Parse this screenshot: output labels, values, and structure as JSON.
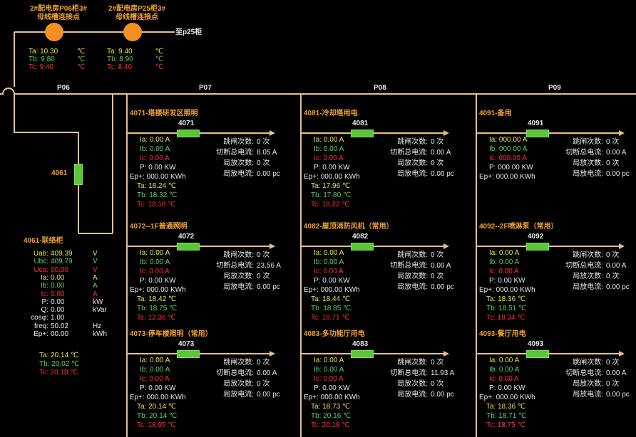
{
  "top_nodes": [
    {
      "line1": "2#配电房P06柜3#",
      "line2": "母线槽连接点",
      "ta": "10.30",
      "tb": "9.80",
      "tc": "9.40",
      "unit": "℃"
    },
    {
      "line1": "2#配电房P25柜3#",
      "line2": "母线槽连接点",
      "ta": "9.40",
      "tb": "8.90",
      "tc": "8.40",
      "unit": "℃"
    }
  ],
  "to_p25": "至p25柜",
  "bus_labels": [
    "P06",
    "P07",
    "P08",
    "P09"
  ],
  "ta_label": "Ta:",
  "tb_label": "Tb:",
  "tc_label": "Tc:",
  "breaker_4061": "4061",
  "tie": {
    "title": "4061-联络柜",
    "rows": [
      {
        "label": "Uab:",
        "value": "409.39",
        "unit": "V",
        "color": "y"
      },
      {
        "label": "Ubc:",
        "value": "409.79",
        "unit": "V",
        "color": "g"
      },
      {
        "label": "Uca:",
        "value": "00.00",
        "unit": "V",
        "color": "r"
      },
      {
        "label": "Ia:",
        "value": "0.00",
        "unit": "A",
        "color": "y"
      },
      {
        "label": "Ib:",
        "value": "0.00",
        "unit": "A",
        "color": "g"
      },
      {
        "label": "Ic:",
        "value": "0.00",
        "unit": "A",
        "color": "r"
      },
      {
        "label": "P:",
        "value": "0.00",
        "unit": "kW",
        "color": "w"
      },
      {
        "label": "Q:",
        "value": "0.00",
        "unit": "kVar",
        "color": "w"
      },
      {
        "label": "cosφ:",
        "value": "1.00",
        "unit": "",
        "color": "w"
      },
      {
        "label": "freq:",
        "value": "50.02",
        "unit": "Hz",
        "color": "w"
      },
      {
        "label": "Ep+:",
        "value": "00.00",
        "unit": "kWh",
        "color": "w"
      }
    ],
    "ta": "Ta: 20.14 ℃",
    "tb": "Tb: 20.02 ℃",
    "tc": "Tc: 20.18 ℃"
  },
  "feeders": [
    {
      "title": "4071-塔楼研发区照明",
      "code": "4071",
      "ia": "Ia: 0.00 A",
      "ib": "Ib: 0.00 A",
      "ic": "Ic: 0.00 A",
      "p": "P: 0.00 KW",
      "ep": "Ep+: 000.00 KWh",
      "ta": "Ta: 18.24 ℃",
      "tb": "Tb: 18.32 ℃",
      "tc": "Tc: 18.18 ℃",
      "trip": "0 次",
      "trip_i": "8.05 A",
      "pd": "0 次",
      "pd_i": "0.00 pc"
    },
    {
      "title": "4081-冷却塔用电",
      "code": "4081",
      "ia": "Ia: 0.00 A",
      "ib": "Ib: 0.00 A",
      "ic": "Ic: 0.00 A",
      "p": "P: 0.00 KW",
      "ep": "Ep+: 000.00 KWh",
      "ta": "Ta: 17.96 ℃",
      "tb": "Tb: 17.80 ℃",
      "tc": "Tc: 18.22 ℃",
      "trip": "0 次",
      "trip_i": "0.00 A",
      "pd": "0 次",
      "pd_i": "0.00 pc"
    },
    {
      "title": "4091-备用",
      "code": "4091",
      "ia": "Ia: 000.00 A",
      "ib": "Ib: 000.00 A",
      "ic": "Ic: 000.00 A",
      "p": "P: 000.00 KW",
      "ep": "Ep+: 000.00 KWh",
      "ta": "",
      "tb": "",
      "tc": "",
      "trip": "0 次",
      "trip_i": "0.00 A",
      "pd": "0 次",
      "pd_i": "0.00 pc"
    },
    {
      "title": "4072--1F普通照明",
      "code": "4072",
      "ia": "Ia: 0.00 A",
      "ib": "Ib: 0.00 A",
      "ic": "Ic: 0.00 A",
      "p": "P: 0.00 KW",
      "ep": "Ep+: 000.00 KWh",
      "ta": "Ta: 18.42 ℃",
      "tb": "Tb: 18.75 ℃",
      "tc": "Tc: 12.36 ℃",
      "trip": "0 次",
      "trip_i": "23.56 A",
      "pd": "0 次",
      "pd_i": "0.00 pc"
    },
    {
      "title": "4082-屋顶消防风机（常用）",
      "code": "4082",
      "ia": "Ia: 0.00 A",
      "ib": "Ib: 0.00 A",
      "ic": "Ic: 0.00 A",
      "p": "P: 0.00 KW",
      "ep": "Ep+: 000.00 KWh",
      "ta": "Ta: 18.44 ℃",
      "tb": "Tb: 18.85 ℃",
      "tc": "Tc: 18.71 ℃",
      "trip": "0 次",
      "trip_i": "0.00 A",
      "pd": "0 次",
      "pd_i": "0.00 pc"
    },
    {
      "title": "4092--2F喷淋泵（常用）",
      "code": "4092",
      "ia": "Ia: 0.00 A",
      "ib": "Ib: 0.00 A",
      "ic": "Ic: 0.00 A",
      "p": "P: 0.00 KW",
      "ep": "Ep+: 000.00 KWh",
      "ta": "Ta: 18.36 ℃",
      "tb": "Tb: 18.51 ℃",
      "tc": "Tc: 18.34 ℃",
      "trip": "0 次",
      "trip_i": "0.00 A",
      "pd": "0 次",
      "pd_i": "0.00 pc"
    },
    {
      "title": "4073-停车楼照明（常用）",
      "code": "4073",
      "ia": "Ia: 0.00 A",
      "ib": "Ib: 0.00 A",
      "ic": "Ic: 0.00 A",
      "p": "P: 0.00 KW",
      "ep": "Ep+: 000.00 KWh",
      "ta": "Ta: 20.14 ℃",
      "tb": "Tb: 20.14 ℃",
      "tc": "Tc: 18.95 ℃",
      "trip": "0 次",
      "trip_i": "0.00 A",
      "pd": "0 次",
      "pd_i": "0.00 pc"
    },
    {
      "title": "4083-多功能厅用电",
      "code": "4083",
      "ia": "Ia: 0.00 A",
      "ib": "Ib: 0.00 A",
      "ic": "Ic: 0.00 A",
      "p": "P: 0.00 KW",
      "ep": "Ep+: 000.00 KWh",
      "ta": "Ta: 18.73 ℃",
      "tb": "Tb: 20.16 ℃",
      "tc": "Tc: 20.18 ℃",
      "trip": "0 次",
      "trip_i": "11.93 A",
      "pd": "0 次",
      "pd_i": "0.00 pc"
    },
    {
      "title": "4093-餐厅用电",
      "code": "4093",
      "ia": "Ia: 0.00 A",
      "ib": "Ib: 0.00 A",
      "ic": "Ic: 0.00 A",
      "p": "P: 0.00 KW",
      "ep": "Ep+: 000.00 KWh",
      "ta": "Ta: 18.36 ℃",
      "tb": "Tb: 18.71 ℃",
      "tc": "Tc: 18.75 ℃",
      "trip": "0 次",
      "trip_i": "0.00 A",
      "pd": "0 次",
      "pd_i": "0.00 pc"
    }
  ],
  "labels": {
    "trip_count": "跳闸次数:",
    "trip_current": "切断总电流:",
    "pd_count": "局放次数:",
    "pd_current": "局放电流:"
  },
  "colors": {
    "bus": "#e6c08a",
    "orange": "#f0a030",
    "green": "#5cd35c",
    "red": "#ff3030",
    "yellow": "#e8e84a"
  }
}
